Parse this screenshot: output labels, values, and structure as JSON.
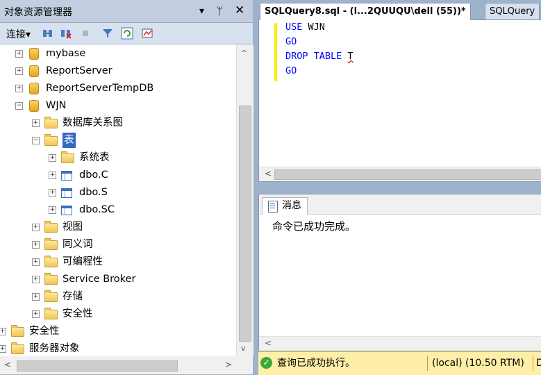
{
  "object_explorer": {
    "title": "对象资源管理器",
    "title_buttons": {
      "dropdown": "▾",
      "pin": "ᛘ",
      "close": "✕"
    },
    "toolbar": {
      "connect_label": "连接▾",
      "icons": [
        "connect-icon",
        "disconnect-icon",
        "stop-icon",
        "filter-icon",
        "refresh-icon",
        "activity-monitor-icon"
      ]
    },
    "tree": [
      {
        "label": "mybase",
        "icon": "database-icon",
        "expander": "+"
      },
      {
        "label": "ReportServer",
        "icon": "database-icon",
        "expander": "+"
      },
      {
        "label": "ReportServerTempDB",
        "icon": "database-icon",
        "expander": "+"
      },
      {
        "label": "WJN",
        "icon": "database-icon",
        "expander": "−"
      },
      {
        "label": "数据库关系图",
        "icon": "folder-icon",
        "expander": "+"
      },
      {
        "label": "表",
        "icon": "folder-icon",
        "expander": "−",
        "selected": true
      },
      {
        "label": "系统表",
        "icon": "folder-icon",
        "expander": "+"
      },
      {
        "label": "dbo.C",
        "icon": "table-icon",
        "expander": "+"
      },
      {
        "label": "dbo.S",
        "icon": "table-icon",
        "expander": "+"
      },
      {
        "label": "dbo.SC",
        "icon": "table-icon",
        "expander": "+"
      },
      {
        "label": "视图",
        "icon": "folder-icon",
        "expander": "+"
      },
      {
        "label": "同义词",
        "icon": "folder-icon",
        "expander": "+"
      },
      {
        "label": "可编程性",
        "icon": "folder-icon",
        "expander": "+"
      },
      {
        "label": "Service Broker",
        "icon": "folder-icon",
        "expander": "+"
      },
      {
        "label": "存储",
        "icon": "folder-icon",
        "expander": "+"
      },
      {
        "label": "安全性",
        "icon": "folder-icon",
        "expander": "+"
      },
      {
        "label": "安全性",
        "icon": "folder-icon",
        "expander": "+"
      },
      {
        "label": "服务器对象",
        "icon": "folder-icon",
        "expander": "+"
      }
    ],
    "scroll": {
      "up": "^",
      "down": "v",
      "left": "<",
      "right": ">"
    }
  },
  "editor": {
    "tabs": [
      {
        "label": "SQLQuery8.sql - (l...2QUUQU\\dell (55))*",
        "active": true
      },
      {
        "label": "SQLQuery",
        "active": false
      }
    ],
    "code": [
      {
        "kw": "USE",
        "rest": "WJN"
      },
      {
        "kw": "GO",
        "rest": ""
      },
      {
        "kw": "DROP TABLE",
        "rest": "T"
      },
      {
        "kw": "GO",
        "rest": ""
      }
    ],
    "scroll_left": "<"
  },
  "results": {
    "tab_label": "消息",
    "message": "命令已成功完成。",
    "scroll_left": "<"
  },
  "status": {
    "text": "查询已成功执行。",
    "server": "(local) (10.50 RTM)",
    "trailing": "D",
    "color": "#ffeea8"
  }
}
